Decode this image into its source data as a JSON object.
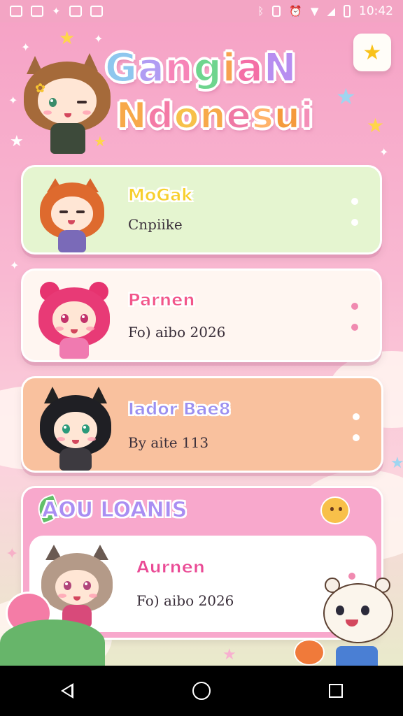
{
  "status_bar": {
    "time": "10:42",
    "left_icons": [
      "image-icon",
      "photo-icon",
      "app-icon",
      "bag-icon",
      "camera-icon"
    ],
    "right_icons": [
      "bluetooth-icon",
      "vibrate-icon",
      "alarm-icon",
      "wifi-icon",
      "signal-icon",
      "battery-icon"
    ]
  },
  "header": {
    "title_line1": "GangiaN",
    "title_line2": "Ndonesui",
    "line1_colors": [
      "#8ec7ee",
      "#b19cf3",
      "#f784b8",
      "#6ed58e",
      "#f7a24e",
      "#f46fa6",
      "#b78ef0"
    ],
    "line2_colors": [
      "#f7a94a",
      "#f47aa6",
      "#f7c04a",
      "#f7a94a",
      "#ef78a4",
      "#ffb36a",
      "#f59a3c",
      "#f48fb8"
    ],
    "favorite_icon": "star-icon"
  },
  "list": [
    {
      "title": "MoGak",
      "subtitle": "Cnpiike",
      "title_color": "#f7cf2e",
      "background": "#e5f5d0",
      "dot_color": "#ffffff"
    },
    {
      "title": "Parnen",
      "subtitle": "Fo) aibo  2026",
      "title_color": "#f2568a",
      "background": "#fff6f1",
      "dot_color": "#f08ab0"
    },
    {
      "title": "Iador Bae8",
      "subtitle": "By aite  113",
      "title_color": "#9b8ff0",
      "background": "#f9c19e",
      "dot_color": "#ffffff"
    }
  ],
  "section": {
    "title": "AOU LOANIS",
    "leaf_icon": "leaf-icon",
    "blob_icon": "smile-blob-icon",
    "item": {
      "title": "Aurnen",
      "subtitle": "Fo) aibo  2026",
      "title_color": "#ea4a95",
      "background": "#ffffff",
      "dot_color": "#f08ab0"
    }
  },
  "nav_bar": {
    "buttons": [
      "back-icon",
      "home-icon",
      "recent-apps-icon"
    ]
  }
}
